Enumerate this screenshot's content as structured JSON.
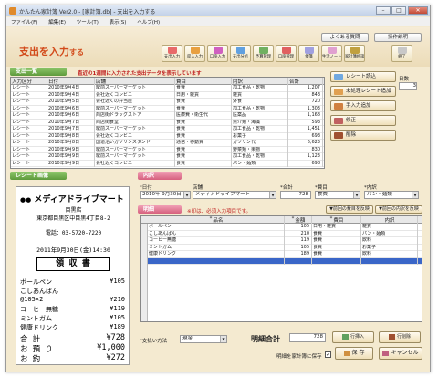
{
  "window": {
    "title": "かんたん家計簿 Ver2.0 - [家計簿.db] - 支出を入力する"
  },
  "menu": [
    "ファイル(F)",
    "編集(E)",
    "ツール(T)",
    "表示(S)",
    "ヘルプ(H)"
  ],
  "top_buttons": {
    "faq": "よくある質問",
    "manual": "操作説明"
  },
  "page_title": {
    "main": "支出を入力",
    "suffix": "する"
  },
  "toolbar": [
    {
      "label": "支出入力",
      "icon": "wallet-icon",
      "color": "#e86a6a"
    },
    {
      "label": "収入入力",
      "icon": "coin-icon",
      "color": "#e8a040"
    },
    {
      "label": "口座入力",
      "icon": "bank-icon",
      "color": "#d060c0"
    },
    {
      "label": "支出分析",
      "icon": "chart-icon",
      "color": "#60a0e0"
    },
    {
      "label": "予算管理",
      "icon": "budget-icon",
      "color": "#70b060"
    },
    {
      "label": "口座管理",
      "icon": "account-icon",
      "color": "#e06060"
    },
    {
      "label": "便箋",
      "icon": "notepad-icon",
      "color": "#a0a0e0"
    },
    {
      "label": "生活ノート",
      "icon": "note-icon",
      "color": "#e0a0d0"
    },
    {
      "label": "家計簿相談",
      "icon": "advice-icon",
      "color": "#c0a040"
    },
    {
      "label": "終了",
      "icon": "exit-icon",
      "color": "#c8c8c8"
    }
  ],
  "list_section": {
    "header": "支出一覧",
    "notice": "直近の1週間に入力された支出データを表示しています",
    "days_label": "日数",
    "days_value": "3"
  },
  "list_columns": [
    "入力区分",
    "日付",
    "店舗",
    "費目",
    "内訳",
    "合計"
  ],
  "list_rows": [
    [
      "レシート",
      "2010年9月4日",
      "駅前スーパーマーケット",
      "食費",
      "加工食品・乾物",
      "1,207"
    ],
    [
      "レシート",
      "2010年9月4日",
      "会社近くコンビニ",
      "日用・雑貨",
      "雑貨",
      "843"
    ],
    [
      "レシート",
      "2010年9月5日",
      "会社近くの弁当屋",
      "食費",
      "外食",
      "720"
    ],
    [
      "レシート",
      "2010年9月6日",
      "駅前スーパーマーケット",
      "食費",
      "加工食品・乾物",
      "1,303"
    ],
    [
      "レシート",
      "2010年9月6日",
      "商店街ドラッグストア",
      "医療費・衛生代",
      "医薬品",
      "1,168"
    ],
    [
      "レシート",
      "2010年9月7日",
      "商店街食堂",
      "食費",
      "魚介類・海藻",
      "593"
    ],
    [
      "レシート",
      "2010年9月7日",
      "駅前スーパーマーケット",
      "食費",
      "加工食品・乾物",
      "1,451"
    ],
    [
      "レシート",
      "2010年9月8日",
      "会社近くコンビニ",
      "食費",
      "お菓子",
      "693"
    ],
    [
      "レシート",
      "2010年9月8日",
      "国道沿いガソリンスタンド",
      "通信・移動費",
      "ガソリン代",
      "6,623"
    ],
    [
      "レシート",
      "2010年9月9日",
      "駅前スーパーマーケット",
      "食費",
      "野菜類・果物",
      "830"
    ],
    [
      "レシート",
      "2010年9月9日",
      "駅前スーパーマーケット",
      "食費",
      "加工食品・乾物",
      "1,123"
    ],
    [
      "レシート",
      "2010年9月9日",
      "会社近くコンビニ",
      "食費",
      "パン・麺類",
      "698"
    ]
  ],
  "action_buttons": [
    {
      "label": "レシート読込",
      "icon": "receipt-scan-icon",
      "color": "#70a8e0"
    },
    {
      "label": "未処理レシート追加",
      "icon": "receipt-add-icon",
      "color": "#e0a050"
    },
    {
      "label": "手入力追加",
      "icon": "manual-add-icon",
      "color": "#d08040"
    },
    {
      "label": "修正",
      "icon": "edit-icon",
      "color": "#c06060"
    },
    {
      "label": "削除",
      "icon": "delete-icon",
      "color": "#a05030"
    }
  ],
  "receipt_section": {
    "header": "レシート画像"
  },
  "receipt": {
    "store": "メディアドライブマート",
    "branch": "目黒店",
    "address": "東京都目黒区中目黒4丁目8-2",
    "tel": "電話：03-5720-7220",
    "datetime": "2011年9月30日(金)14:30",
    "heading": "領 収 書",
    "items": [
      {
        "name": "ボールペン",
        "price": "¥105"
      },
      {
        "name": "こしあんぱん",
        "price": ""
      },
      {
        "name": "  @105×2",
        "price": "¥210"
      },
      {
        "name": "コーヒー無糖",
        "price": "¥119"
      },
      {
        "name": "ミントガム",
        "price": "¥105"
      },
      {
        "name": "健康ドリンク",
        "price": "¥189"
      },
      {
        "name": "合 計",
        "price": "¥728"
      },
      {
        "name": "お 預 り",
        "price": "¥1,000"
      },
      {
        "name": "お 釣",
        "price": "¥272"
      }
    ]
  },
  "detail_section": {
    "header": "内訳",
    "date_label": "日付",
    "store_label": "店舗",
    "total_label": "合計",
    "category_label": "費目",
    "subcategory_label": "内訳",
    "date_value": "2010年 9月30日",
    "store_value": "メディアドライブマート",
    "total_value": "728",
    "category_value": "食費",
    "subcategory_value": "パン・麺類"
  },
  "item_section": {
    "header": "明細",
    "notice": "※印は、必須入力項目です。",
    "prev_link": "前回の費目を反映",
    "copy_link": "前回の内訳を反映"
  },
  "item_columns": [
    "品名",
    "金額",
    "費目",
    "内訳"
  ],
  "item_rows": [
    [
      "ボールペン",
      "105",
      "日用・雑貨",
      "雑貨"
    ],
    [
      "こしあんぱん",
      "210",
      "食費",
      "パン・麺類"
    ],
    [
      "コーヒー無糖",
      "119",
      "食費",
      "飲料"
    ],
    [
      "ミントガム",
      "105",
      "食費",
      "お菓子"
    ],
    [
      "健康ドリンク",
      "189",
      "食費",
      "飲料"
    ]
  ],
  "footer": {
    "payment_label": "支払い方法",
    "payment_value": "現金",
    "total_label": "明細合計",
    "total_value": "728",
    "add_row": "行挿入",
    "delete_row": "行削除",
    "checkbox_label": "明細を家計簿に保存",
    "save": "保 存",
    "cancel": "キャンセル"
  }
}
